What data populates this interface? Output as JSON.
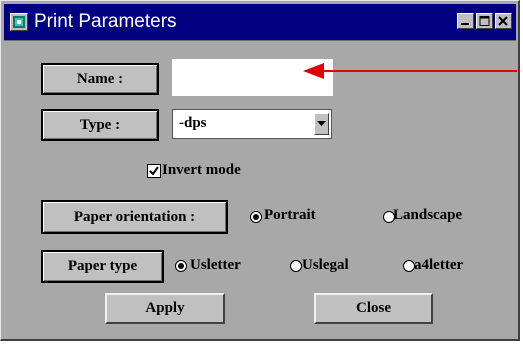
{
  "window": {
    "title": "Print Parameters"
  },
  "icons": {
    "app": "app-window-icon",
    "minimize": "minimize-icon",
    "maximize": "maximize-icon",
    "close": "close-icon",
    "dropdown": "chevron-down-icon",
    "checkmark": "checkmark-icon"
  },
  "colors": {
    "titlebar": "#000080",
    "window": "#a8a8a8",
    "button": "#c0c0c0",
    "arrow": "#e00000"
  },
  "fields": {
    "name": {
      "label": "Name :",
      "value": "",
      "placeholder": ""
    },
    "type": {
      "label": "Type :",
      "value": "-dps"
    }
  },
  "invert_mode": {
    "label": "Invert mode",
    "checked": true
  },
  "paper_orientation": {
    "label": "Paper orientation :",
    "options": [
      {
        "label": "Portrait",
        "selected": true
      },
      {
        "label": "Landscape",
        "selected": false
      }
    ]
  },
  "paper_type": {
    "label": "Paper type",
    "options": [
      {
        "label": "Usletter",
        "selected": true
      },
      {
        "label": "Uslegal",
        "selected": false
      },
      {
        "label": "a4letter",
        "selected": false
      }
    ]
  },
  "buttons": {
    "apply": "Apply",
    "close": "Close"
  }
}
